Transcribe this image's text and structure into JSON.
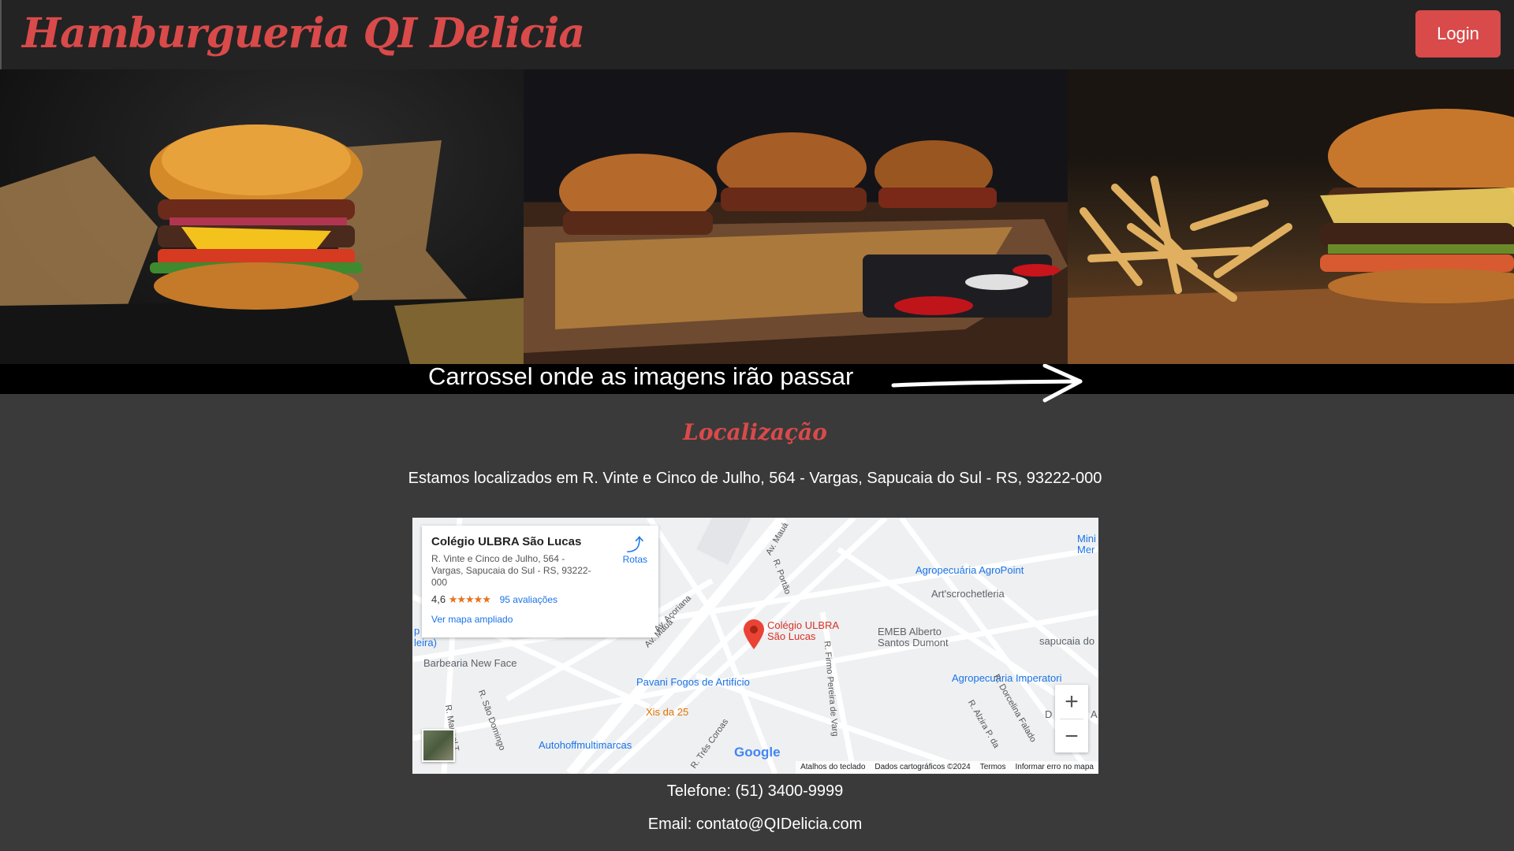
{
  "header": {
    "brand": "Hamburgueria QI Delicia",
    "login_label": "Login"
  },
  "carousel": {
    "caption": "Carrossel onde as imagens irão passar",
    "slides": [
      "burger-on-paper-photo",
      "three-burgers-with-fries-photo",
      "burger-and-fries-photo"
    ]
  },
  "location": {
    "title": "Localização",
    "address": "Estamos localizados em R. Vinte e Cinco de Julho, 564 - Vargas, Sapucaia do Sul - RS, 93222-000"
  },
  "map": {
    "card": {
      "title": "Colégio ULBRA São Lucas",
      "address": "R. Vinte e Cinco de Julho, 564 - Vargas, Sapucaia do Sul - RS, 93222-000",
      "rating": "4,6",
      "stars": "★★★★★",
      "reviews": "95 avaliações",
      "link": "Ver mapa ampliado",
      "route": "Rotas"
    },
    "places": {
      "main": "Colégio ULBRA São Lucas",
      "agro": "Agropecuária AgroPoint",
      "art": "Art'scrochetleria",
      "emeb": "EMEB Alberto Santos Dumont",
      "sapucaia": "sapucaia do",
      "agro2": "Agropecuária Imperatori",
      "barbearia": "Barbearia New Face",
      "pavani": "Pavani Fogos de Artifício",
      "xis": "Xis da 25",
      "auto": "Autohoffmultimarcas",
      "minimer": "Mini Mer",
      "leira": "leira)",
      "p_sq": "p"
    },
    "streets": {
      "maua1": "Av. Mauá",
      "maua2": "Av. Mauá",
      "acoriana": "Av. Açoriana",
      "portao": "R. Portão",
      "firmo": "R. Firmo Pereira de Varg",
      "saodomingos": "R. São Domingo",
      "manoel": "R. Manoel T",
      "trescoroas": "R. Três Coroas",
      "dorcelina": "R. Dorcelina Falado",
      "alzira": "R. Alzira P. da",
      "dona": "D",
      "avA": "A"
    },
    "google": "Google",
    "attribution": [
      "Atalhos do teclado",
      "Dados cartográficos ©2024",
      "Termos",
      "Informar erro no mapa"
    ],
    "zoom_in": "+",
    "zoom_out": "−"
  },
  "contact": {
    "phone": "Telefone: (51) 3400-9999",
    "email": "Email: contato@QIDelicia.com"
  },
  "colors": {
    "accent": "#d94a4a",
    "topbar": "#232323",
    "page_bg": "#3a3a3a"
  }
}
